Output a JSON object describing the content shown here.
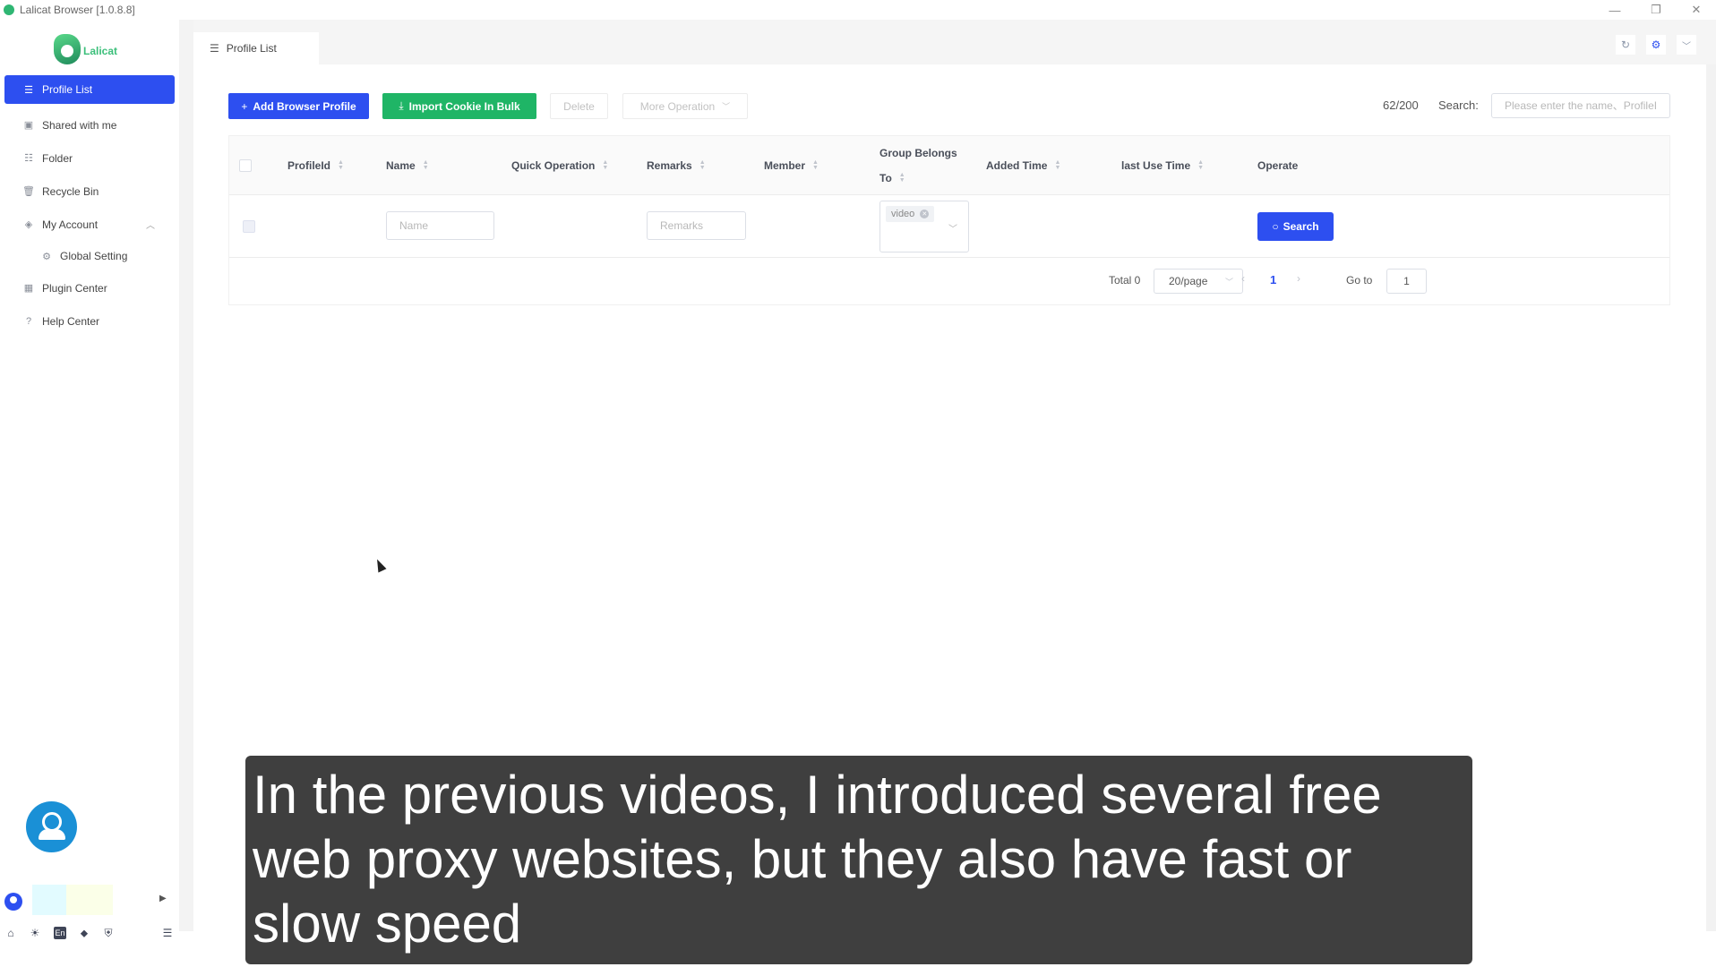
{
  "window": {
    "title": "Lalicat Browser  [1.0.8.8]",
    "controls": {
      "minimize": "—",
      "maximize": "❐",
      "close": "✕"
    }
  },
  "sidebar": {
    "brand": "Lalicat",
    "items": [
      {
        "label": "Profile List",
        "icon": "list-icon",
        "glyph": "☰",
        "active": true
      },
      {
        "label": "Shared with me",
        "icon": "shared-folder-icon",
        "glyph": "▣"
      },
      {
        "label": "Folder",
        "icon": "folder-icon",
        "glyph": "☷"
      },
      {
        "label": "Recycle Bin",
        "icon": "recycle-bin-icon",
        "glyph": "🗑"
      },
      {
        "label": "My Account",
        "icon": "account-icon",
        "glyph": "◈",
        "expanded": true,
        "caret": "︿"
      },
      {
        "label": "Global Setting",
        "icon": "gear-icon",
        "glyph": "⚙",
        "sub": true
      },
      {
        "label": "Plugin Center",
        "icon": "plugin-icon",
        "glyph": "▦"
      },
      {
        "label": "Help Center",
        "icon": "help-icon",
        "glyph": "?"
      }
    ],
    "user_arrow": "▶",
    "bottom_icons": {
      "home": "⌂",
      "theme": "☀",
      "language": "En",
      "tag": "⬥",
      "shield": "⛨",
      "collapse": "☰"
    }
  },
  "tabs": [
    {
      "label": "Profile List",
      "glyph": "☰"
    }
  ],
  "tabbar_icons": {
    "reload": "↻",
    "settings": "⚙",
    "more": "﹀"
  },
  "toolbar": {
    "add_label": "Add Browser Profile",
    "add_glyph": "+",
    "import_label": "Import Cookie In Bulk",
    "import_glyph": "⤓",
    "delete_label": "Delete",
    "more_label": "More Operation",
    "more_chev": "﹀",
    "counter": "62/200",
    "search_label": "Search:",
    "search_placeholder": "Please enter the name、ProfileI"
  },
  "table": {
    "columns": [
      {
        "key": "profileid",
        "label": "ProfileId"
      },
      {
        "key": "name",
        "label": "Name"
      },
      {
        "key": "quick",
        "label": "Quick Operation"
      },
      {
        "key": "remarks",
        "label": "Remarks"
      },
      {
        "key": "member",
        "label": "Member"
      },
      {
        "key": "group",
        "label": "Group Belongs",
        "label2": "To"
      },
      {
        "key": "added",
        "label": "Added Time"
      },
      {
        "key": "lastuse",
        "label": "last Use Time"
      },
      {
        "key": "operate",
        "label": "Operate"
      }
    ],
    "sort_up": "▲",
    "sort_down": "▼",
    "filters": {
      "name_placeholder": "Name",
      "remarks_placeholder": "Remarks",
      "group_tags": [
        "video"
      ],
      "group_chev": "﹀",
      "search_button": "Search",
      "search_glyph": "○"
    },
    "rows": []
  },
  "pagination": {
    "total": "Total 0",
    "page_size": "20/page",
    "page_size_chev": "﹀",
    "prev": "‹",
    "current": "1",
    "next": "›",
    "goto_label": "Go to",
    "goto_value": "1"
  },
  "caption": "In the previous videos, I introduced several free web proxy websites, but they also have fast or slow speed",
  "colors": {
    "primary": "#2d4ff0",
    "success": "#1fb566",
    "brand_green": "#3bbf7a",
    "caption_bg": "#3f3f3f"
  }
}
